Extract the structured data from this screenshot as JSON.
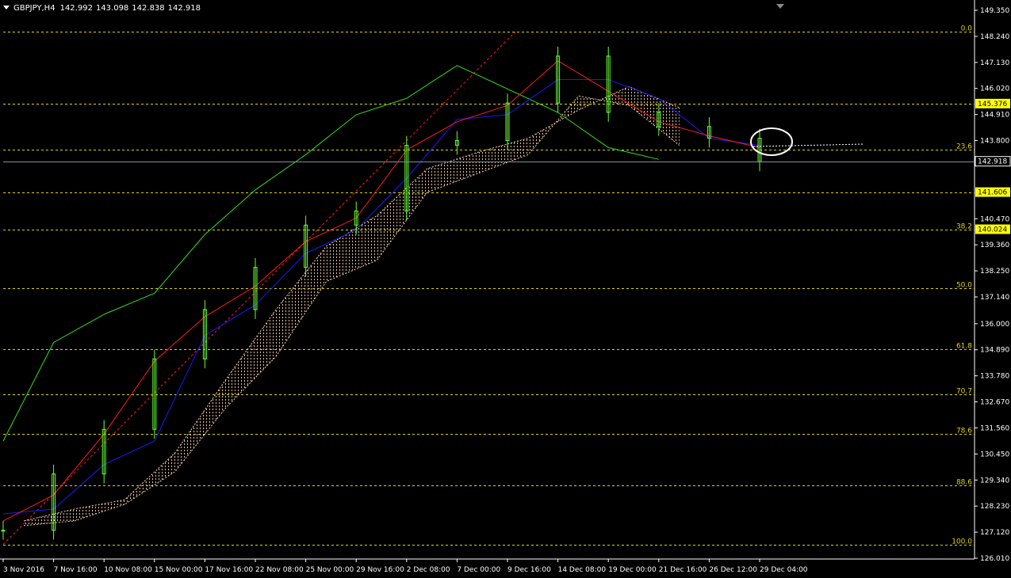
{
  "chart_header": {
    "symbol_timeframe": "GBPJPY,H4",
    "open": "142.992",
    "high": "143.098",
    "low": "142.838",
    "close": "142.918"
  },
  "colors": {
    "background": "#000000",
    "candle": "#66ff33",
    "chikou": "#33dd22",
    "tenkan": "#ff1a1a",
    "kijun": "#1a1aff",
    "cloud": "#ffd2aa",
    "fibo": "#e0d600",
    "price_tag": "#ffff00",
    "circle": "#ffffff"
  },
  "price_axis": {
    "ticks": [
      "149.350",
      "148.240",
      "147.130",
      "146.020",
      "144.910",
      "143.800",
      "140.470",
      "139.360",
      "138.250",
      "137.140",
      "136.000",
      "134.890",
      "133.780",
      "132.670",
      "131.560",
      "130.450",
      "129.340",
      "128.230",
      "127.120",
      "126.010"
    ],
    "range": [
      126.01,
      149.35
    ]
  },
  "price_tags": [
    {
      "label": "145.376",
      "price": 145.376,
      "style": "fibo"
    },
    {
      "label": "142.918",
      "price": 142.918,
      "style": "current"
    },
    {
      "label": "141.606",
      "price": 141.606,
      "style": "fibo"
    },
    {
      "label": "140.024",
      "price": 140.024,
      "style": "fibo"
    }
  ],
  "fibo_levels": [
    {
      "label": "0.0",
      "price": 148.44
    },
    {
      "label": "23.6",
      "price": 143.4
    },
    {
      "label": "",
      "price": 145.376
    },
    {
      "label": "",
      "price": 141.606
    },
    {
      "label": "38.2",
      "price": 140.024
    },
    {
      "label": "50.0",
      "price": 137.5
    },
    {
      "label": "61.8",
      "price": 134.9
    },
    {
      "label": "70.7",
      "price": 133.0
    },
    {
      "label": "78.6",
      "price": 131.3
    },
    {
      "label": "88.6",
      "price": 129.1
    },
    {
      "label": "100.0",
      "price": 126.6
    }
  ],
  "time_axis": {
    "labels": [
      "3 Nov 2016",
      "7 Nov 16:00",
      "10 Nov 08:00",
      "15 Nov 00:00",
      "17 Nov 16:00",
      "22 Nov 08:00",
      "25 Nov 00:00",
      "29 Nov 16:00",
      "2 Dec 08:00",
      "7 Dec 00:00",
      "9 Dec 16:00",
      "14 Dec 08:00",
      "19 Dec 00:00",
      "21 Dec 16:00",
      "26 Dec 12:00",
      "29 Dec 04:00"
    ]
  },
  "chart_data": {
    "type": "candlestick-ichimoku",
    "symbol": "GBPJPY",
    "timeframe": "H4",
    "ylim": [
      126.01,
      149.35
    ],
    "close_path": {
      "x": [
        "3 Nov 2016",
        "7 Nov 16:00",
        "10 Nov 08:00",
        "15 Nov 00:00",
        "17 Nov 16:00",
        "22 Nov 08:00",
        "25 Nov 00:00",
        "29 Nov 16:00",
        "2 Dec 08:00",
        "7 Dec 00:00",
        "9 Dec 16:00",
        "14 Dec 08:00",
        "19 Dec 00:00",
        "21 Dec 16:00",
        "26 Dec 12:00",
        "29 Dec 04:00"
      ],
      "y": [
        127.2,
        129.6,
        131.5,
        134.5,
        136.6,
        138.4,
        140.2,
        140.8,
        143.6,
        143.8,
        145.4,
        147.4,
        145.0,
        144.4,
        143.9,
        142.9
      ]
    },
    "tenkan": [
      127.6,
      128.7,
      131.3,
      134.4,
      136.3,
      137.6,
      139.5,
      140.5,
      143.4,
      144.6,
      145.3,
      147.2,
      145.9,
      144.6,
      144.0,
      143.5
    ],
    "kijun": [
      127.9,
      128.1,
      130.0,
      131.0,
      135.5,
      136.8,
      139.0,
      140.0,
      142.2,
      144.7,
      144.9,
      146.4,
      146.4,
      145.6,
      143.9,
      143.6
    ],
    "chikou": [
      131.0,
      135.2,
      136.4,
      137.3,
      139.8,
      141.7,
      143.2,
      144.9,
      145.6,
      147.0,
      146.0,
      145.0,
      143.5,
      143.0
    ],
    "cloud": {
      "span_a": [
        127.6,
        128.1,
        128.5,
        130.5,
        133.6,
        136.6,
        139.3,
        140.6,
        142.6,
        143.3,
        143.9,
        145.1,
        146.1,
        145.2
      ],
      "span_b": [
        127.4,
        127.6,
        128.3,
        129.7,
        132.4,
        134.6,
        137.8,
        138.7,
        141.6,
        142.4,
        143.2,
        145.7,
        145.3,
        143.6
      ]
    },
    "current_price": 142.918
  }
}
